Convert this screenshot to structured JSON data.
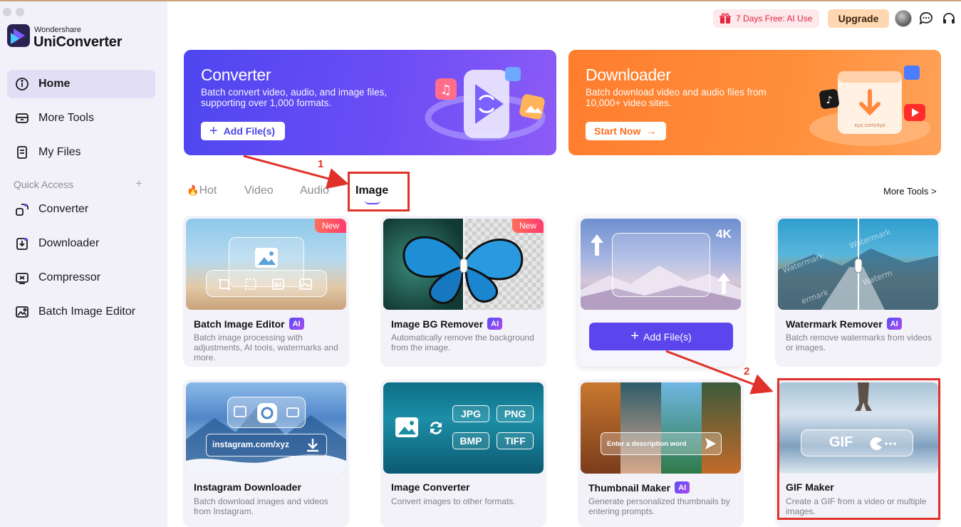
{
  "app": {
    "brand_small": "Wondershare",
    "brand_big": "UniConverter"
  },
  "sidebar": {
    "items": [
      {
        "label": "Home",
        "icon": "home-icon"
      },
      {
        "label": "More Tools",
        "icon": "toolbox-icon"
      },
      {
        "label": "My Files",
        "icon": "files-icon"
      }
    ],
    "quick_access_label": "Quick Access",
    "quick_items": [
      {
        "label": "Converter",
        "icon": "converter-icon"
      },
      {
        "label": "Downloader",
        "icon": "downloader-icon"
      },
      {
        "label": "Compressor",
        "icon": "compressor-icon"
      },
      {
        "label": "Batch Image Editor",
        "icon": "image-editor-icon"
      }
    ]
  },
  "topbar": {
    "promo": "7 Days Free: AI Use",
    "upgrade": "Upgrade"
  },
  "banners": {
    "converter": {
      "title": "Converter",
      "desc": "Batch convert video, audio, and image files, supporting over 1,000 formats.",
      "button": "Add File(s)"
    },
    "downloader": {
      "title": "Downloader",
      "desc": "Batch download video and audio files from 10,000+ video sites.",
      "button": "Start Now",
      "art_text": "xyz.com/xyz"
    }
  },
  "tabs": {
    "hot": "Hot",
    "video": "Video",
    "audio": "Audio",
    "image": "Image",
    "more_tools": "More Tools >"
  },
  "cards": {
    "batch_editor": {
      "title": "Batch Image Editor",
      "desc": "Batch image processing with adjustments, AI tools, watermarks and more.",
      "badge": "New"
    },
    "bg_remover": {
      "title": "Image BG Remover",
      "desc": "Automatically remove the background from the image.",
      "badge": "New"
    },
    "upscaler": {
      "res": "4K",
      "button": "Add File(s)"
    },
    "watermark": {
      "title": "Watermark Remover",
      "desc": "Batch remove watermarks from videos or images.",
      "wm": "Watermark"
    },
    "instagram": {
      "title": "Instagram Downloader",
      "desc": "Batch download images and videos from Instagram.",
      "url": "instagram.com/xyz"
    },
    "converter": {
      "title": "Image Converter",
      "desc": "Convert images to other formats.",
      "formats": [
        "JPG",
        "PNG",
        "BMP",
        "TIFF"
      ]
    },
    "thumbnail": {
      "title": "Thumbnail Maker",
      "desc": "Generate personalized thumbnails by entering prompts.",
      "prompt": "Enter a description word"
    },
    "gif": {
      "title": "GIF Maker",
      "desc": "Create a GIF from a video or multiple images.",
      "art": "GIF"
    }
  },
  "ai_badge": "AI",
  "annotations": {
    "one": "1",
    "two": "2"
  },
  "colors": {
    "accent": "#5b45ec",
    "annotation": "#e0312b",
    "orange": "#ff7d2e"
  }
}
